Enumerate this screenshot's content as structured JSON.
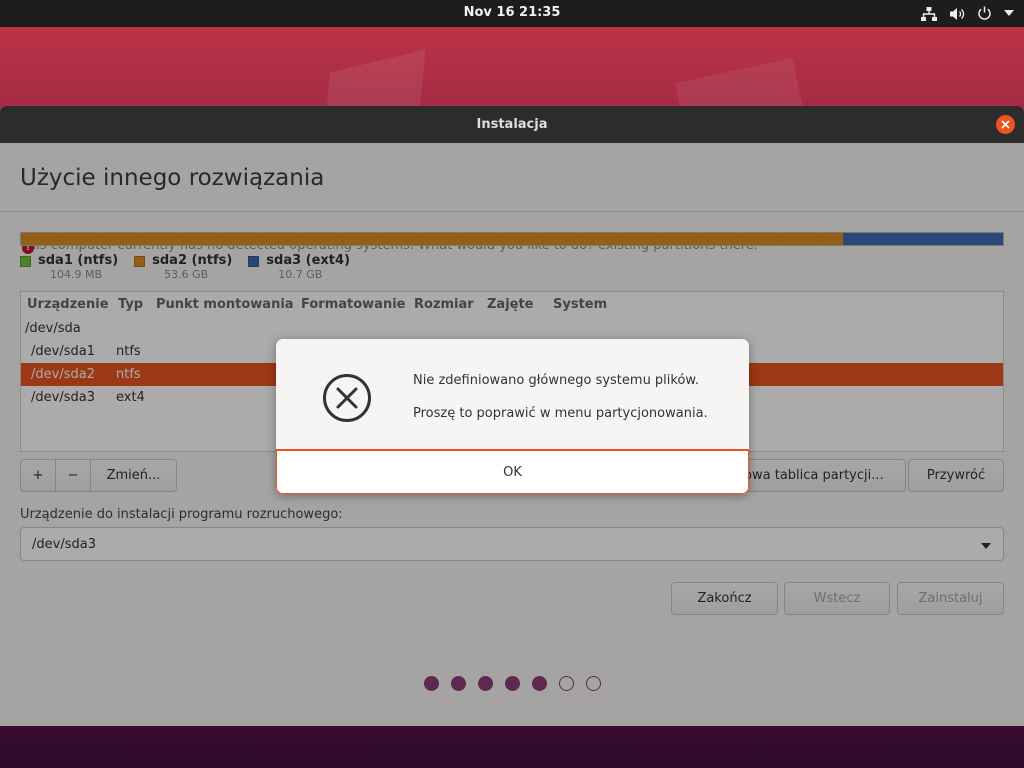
{
  "topbar": {
    "clock": "Nov 16  21:35",
    "icons": [
      "network-icon",
      "volume-icon",
      "power-icon",
      "chevron-down-icon"
    ]
  },
  "window": {
    "title": "Instalacja",
    "close_color": "#e95420"
  },
  "page": {
    "title": "Użycie innego rozwiązania",
    "warning_text": "This computer currently has no detected operating systems. What would you like to do? existing partitions there."
  },
  "partition_bar": {
    "segments": [
      {
        "name": "sda1 (ntfs)",
        "size": "104.9 MB",
        "color": "#76c043",
        "share": 0.0001
      },
      {
        "name": "sda2 (ntfs)",
        "size": "53.6 GB",
        "color": "#e08d23",
        "share": 0.8336
      },
      {
        "name": "sda3 (ext4)",
        "size": "10.7 GB",
        "color": "#3c6eb4",
        "share": 0.1663
      }
    ]
  },
  "table": {
    "columns": [
      "Urządzenie",
      "Typ",
      "Punkt montowania",
      "Formatowanie",
      "Rozmiar",
      "Zajęte",
      "System"
    ],
    "rows": [
      {
        "device": "/dev/sda",
        "type": "",
        "selected": false,
        "indent": false
      },
      {
        "device": "/dev/sda1",
        "type": "ntfs",
        "selected": false,
        "indent": true
      },
      {
        "device": "/dev/sda2",
        "type": "ntfs",
        "selected": true,
        "indent": true
      },
      {
        "device": "/dev/sda3",
        "type": "ext4",
        "selected": false,
        "indent": true
      }
    ]
  },
  "toolbar": {
    "add_label": "+",
    "remove_label": "−",
    "change_label": "Zmień...",
    "new_table_label": "Nowa tablica partycji...",
    "revert_label": "Przywróć"
  },
  "boot": {
    "label": "Urządzenie do instalacji programu rozruchowego:",
    "value": "/dev/sda3"
  },
  "nav": {
    "quit_label": "Zakończ",
    "back_label": "Wstecz",
    "install_label": "Zainstaluj"
  },
  "progress": {
    "total": 7,
    "completed": 5,
    "color": "#8e3d79"
  },
  "dialog": {
    "icon": "error-circle-x-icon",
    "primary_text": "Nie zdefiniowano głównego systemu plików.",
    "secondary_text": "Proszę to poprawić w menu partycjonowania.",
    "ok_label": "OK",
    "accent": "#e95420"
  }
}
